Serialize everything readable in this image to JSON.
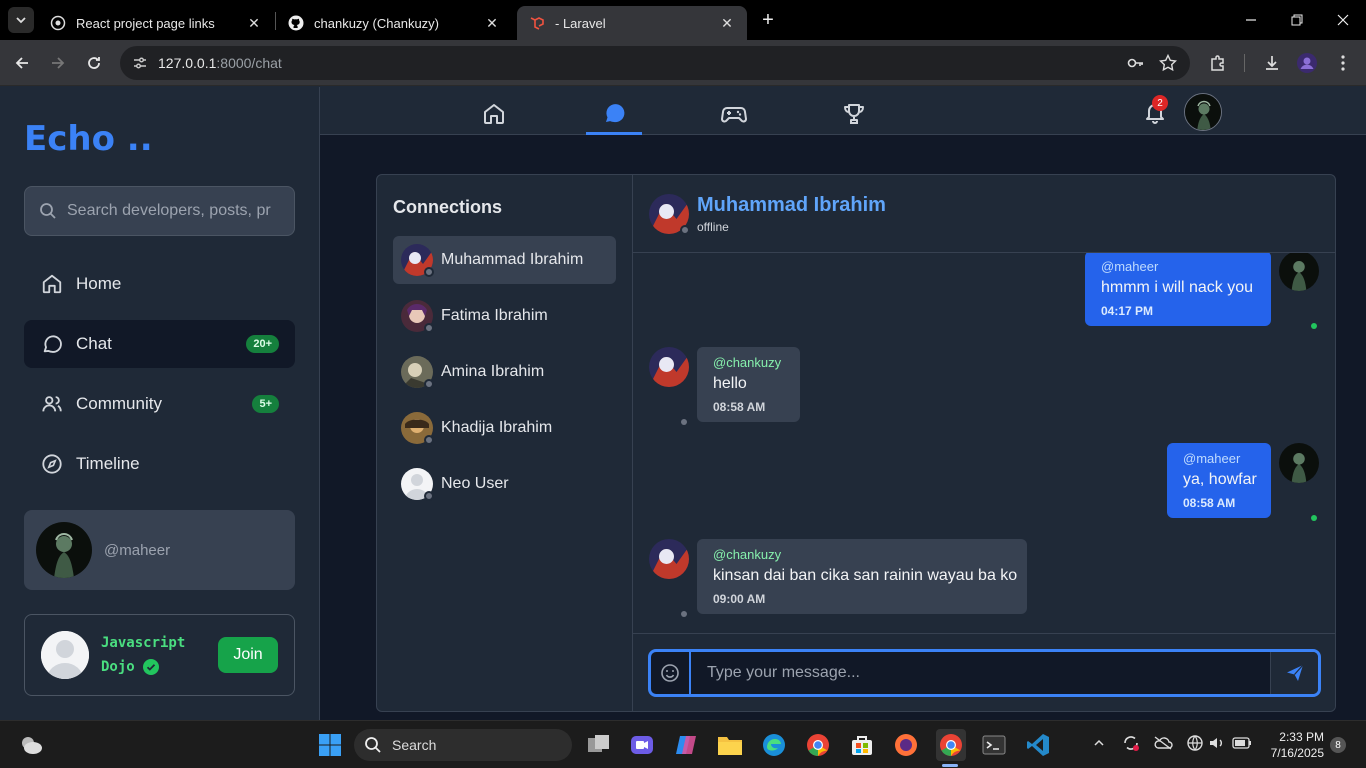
{
  "browser": {
    "tabs": [
      {
        "title": "React project page links"
      },
      {
        "title": "chankuzy (Chankuzy)"
      },
      {
        "title": "- Laravel"
      }
    ],
    "url_host": "127.0.0.1",
    "url_rest": ":8000/chat"
  },
  "app": {
    "logo": "Echo ..",
    "search_placeholder": "Search developers, posts, pr",
    "nav": [
      {
        "label": "Home"
      },
      {
        "label": "Chat",
        "badge": "20+"
      },
      {
        "label": "Community",
        "badge": "5+"
      },
      {
        "label": "Timeline"
      }
    ],
    "user_handle": "@maheer",
    "dojo": {
      "name_line1": "Javascript",
      "name_line2": "Dojo",
      "join_label": "Join"
    },
    "notifications_count": "2"
  },
  "chat": {
    "connections_title": "Connections",
    "connections": [
      {
        "name": "Muhammad Ibrahim"
      },
      {
        "name": "Fatima Ibrahim"
      },
      {
        "name": "Amina Ibrahim"
      },
      {
        "name": "Khadija Ibrahim"
      },
      {
        "name": "Neo User"
      }
    ],
    "header": {
      "name": "Muhammad Ibrahim",
      "status": "offline"
    },
    "messages": [
      {
        "from": "@maheer",
        "text": "hmmm i will nack you",
        "time": "04:17 PM"
      },
      {
        "from": "@chankuzy",
        "text": "hello",
        "time": "08:58 AM"
      },
      {
        "from": "@maheer",
        "text": "ya, howfar",
        "time": "08:58 AM"
      },
      {
        "from": "@chankuzy",
        "text": "kinsan dai ban cika san rainin wayau ba ko",
        "time": "09:00 AM"
      }
    ],
    "input_placeholder": "Type your message..."
  },
  "taskbar": {
    "search_label": "Search",
    "time": "2:33 PM",
    "date": "7/16/2025",
    "notifications": "8"
  },
  "colors": {
    "accent": "#3b82f6",
    "brand_green": "#16a34a",
    "online": "#22c55e",
    "badge_red": "#dc2626"
  }
}
